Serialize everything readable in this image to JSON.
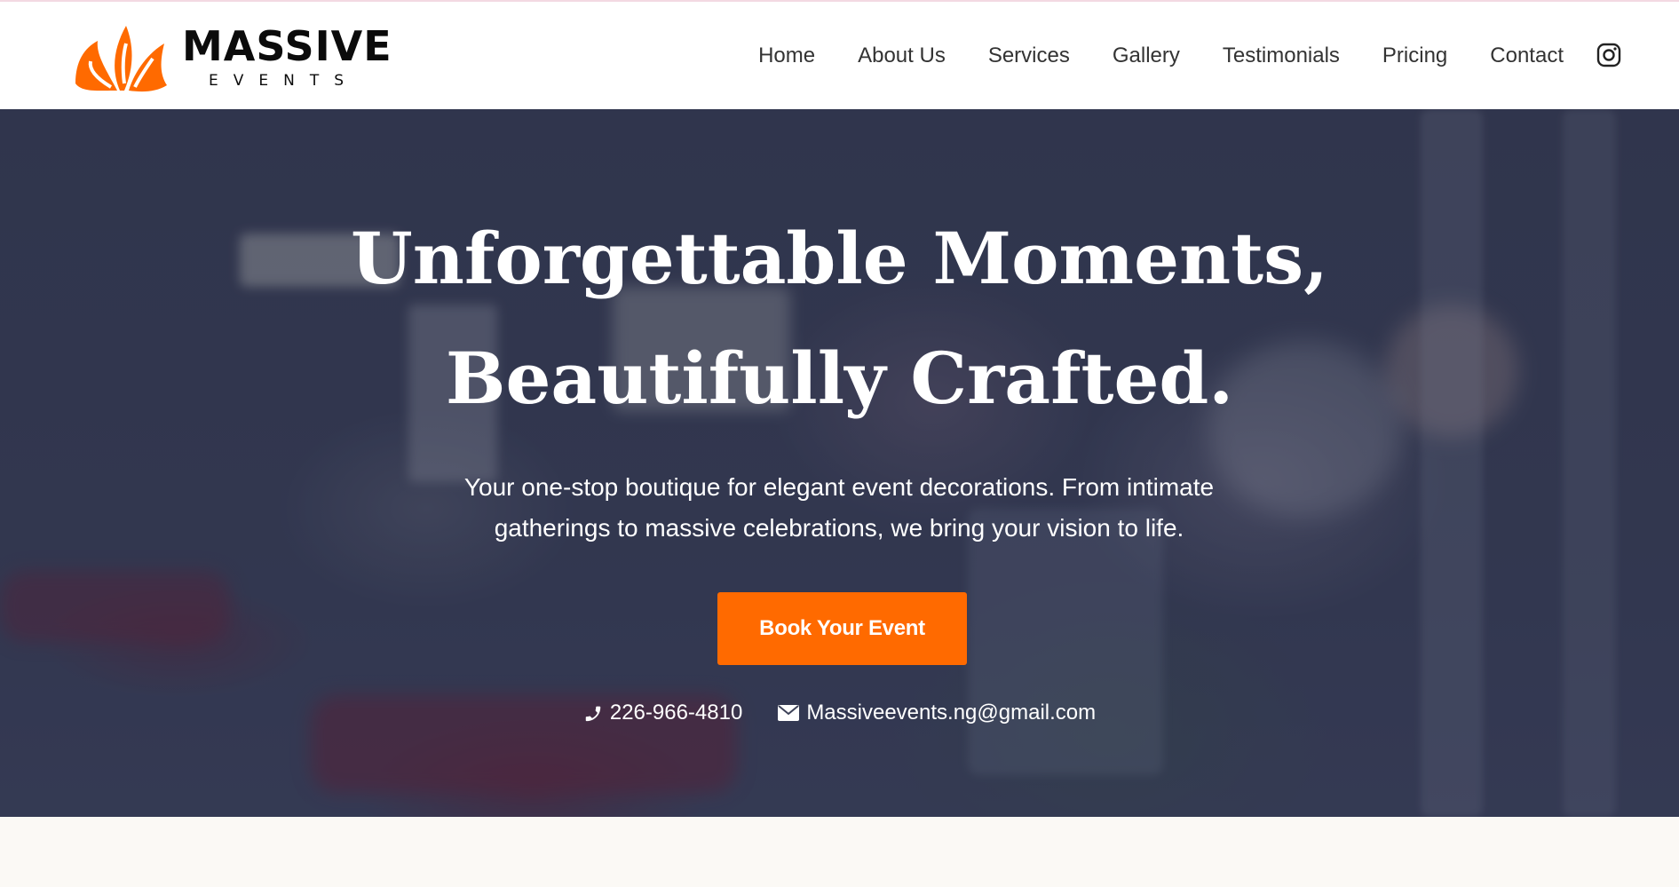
{
  "brand": {
    "name": "MASSIVE",
    "tagline": "EVENTS",
    "accent_color": "#ff6a00"
  },
  "nav": {
    "items": [
      {
        "label": "Home"
      },
      {
        "label": "About Us"
      },
      {
        "label": "Services"
      },
      {
        "label": "Gallery"
      },
      {
        "label": "Testimonials"
      },
      {
        "label": "Pricing"
      },
      {
        "label": "Contact"
      }
    ],
    "social_icon": "instagram-icon"
  },
  "hero": {
    "title_line1": "Unforgettable Moments,",
    "title_line2": "Beautifully Crafted.",
    "subtitle_line1": "Your one-stop boutique for elegant event decorations. From intimate",
    "subtitle_line2": "gatherings to massive celebrations, we bring your vision to life.",
    "cta_label": "Book Your Event",
    "phone": "226-966-4810",
    "email": "Massiveevents.ng@gmail.com",
    "phone_icon": "phone-icon",
    "email_icon": "envelope-icon"
  }
}
